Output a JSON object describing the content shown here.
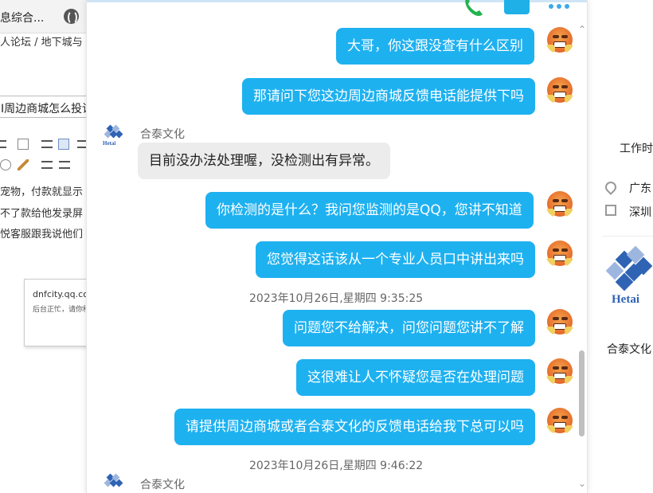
{
  "background_page": {
    "tab_title": "息综合...",
    "breadcrumb": "人论坛 / 地下城与",
    "title_input_value": "I周边商城怎么投诉",
    "body_lines": [
      "宠物，付款就显示",
      "不了款给他发录屏",
      "悦客服跟我说他们"
    ],
    "card": {
      "url": "dnfcity.qq.com",
      "text": "后台正忙，请你稍"
    }
  },
  "side_panel": {
    "hours_label": "工作时",
    "address": "广东",
    "city": "深圳",
    "logo_text": "Hetai",
    "company_name": "合泰文化"
  },
  "chat": {
    "messages": [
      {
        "direction": "out",
        "text": "大哥，你这跟没查有什么区别"
      },
      {
        "direction": "out",
        "text": "那请问下您这边周边商城反馈电话能提供下吗"
      },
      {
        "direction": "in",
        "sender": "合泰文化",
        "text": "目前没办法处理喔，没检测出有异常。"
      },
      {
        "direction": "out",
        "text": "你检测的是什么？我问您监测的是QQ，您讲不知道"
      },
      {
        "direction": "out",
        "text": "您觉得这话该从一个专业人员口中讲出来吗"
      },
      {
        "direction": "out",
        "text": "问题您不给解决，问您问题您讲不了解"
      },
      {
        "direction": "out",
        "text": "这很难让人不怀疑您是否在处理问题"
      },
      {
        "direction": "out",
        "text": "请提供周边商城或者合泰文化的反馈电话给我下总可以吗"
      }
    ],
    "timestamps": [
      "2023年10月26日,星期四 9:35:25",
      "2023年10月26日,星期四 9:46:22"
    ],
    "last_sender": "合泰文化",
    "company_avatar_text": "Hetai",
    "company_avatar_sub": "合泰文化"
  },
  "colors": {
    "outgoing_bubble": "#1eb1f0",
    "incoming_bubble": "#ececec",
    "brand_blue": "#2f63b4"
  },
  "icons": [
    "phone-icon",
    "video-call-icon",
    "more-icon",
    "globe-icon",
    "location-pin-icon",
    "building-icon",
    "scroll-up-icon",
    "scroll-down-icon"
  ]
}
